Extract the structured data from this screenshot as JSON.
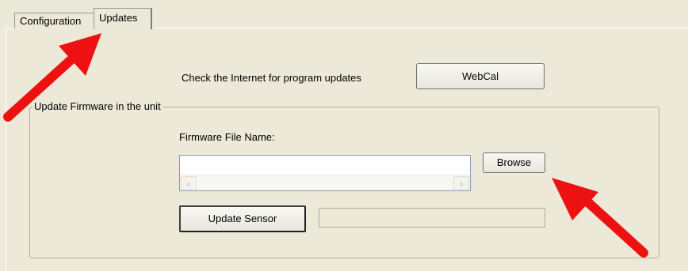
{
  "tabs": [
    {
      "label": "Configuration",
      "active": false
    },
    {
      "label": "Updates",
      "active": true
    }
  ],
  "internet_check": {
    "label": "Check the Internet for program updates",
    "button_label": "WebCal"
  },
  "firmware_group": {
    "title": "Update Firmware in the unit",
    "file_label": "Firmware File Name:",
    "file_value": "",
    "browse_label": "Browse",
    "update_label": "Update Sensor",
    "progress": 0
  },
  "colors": {
    "background": "#ece9d8",
    "annotation_arrow": "#ee1111"
  },
  "icons": {
    "scroll_left": "‹",
    "scroll_right": "›"
  }
}
